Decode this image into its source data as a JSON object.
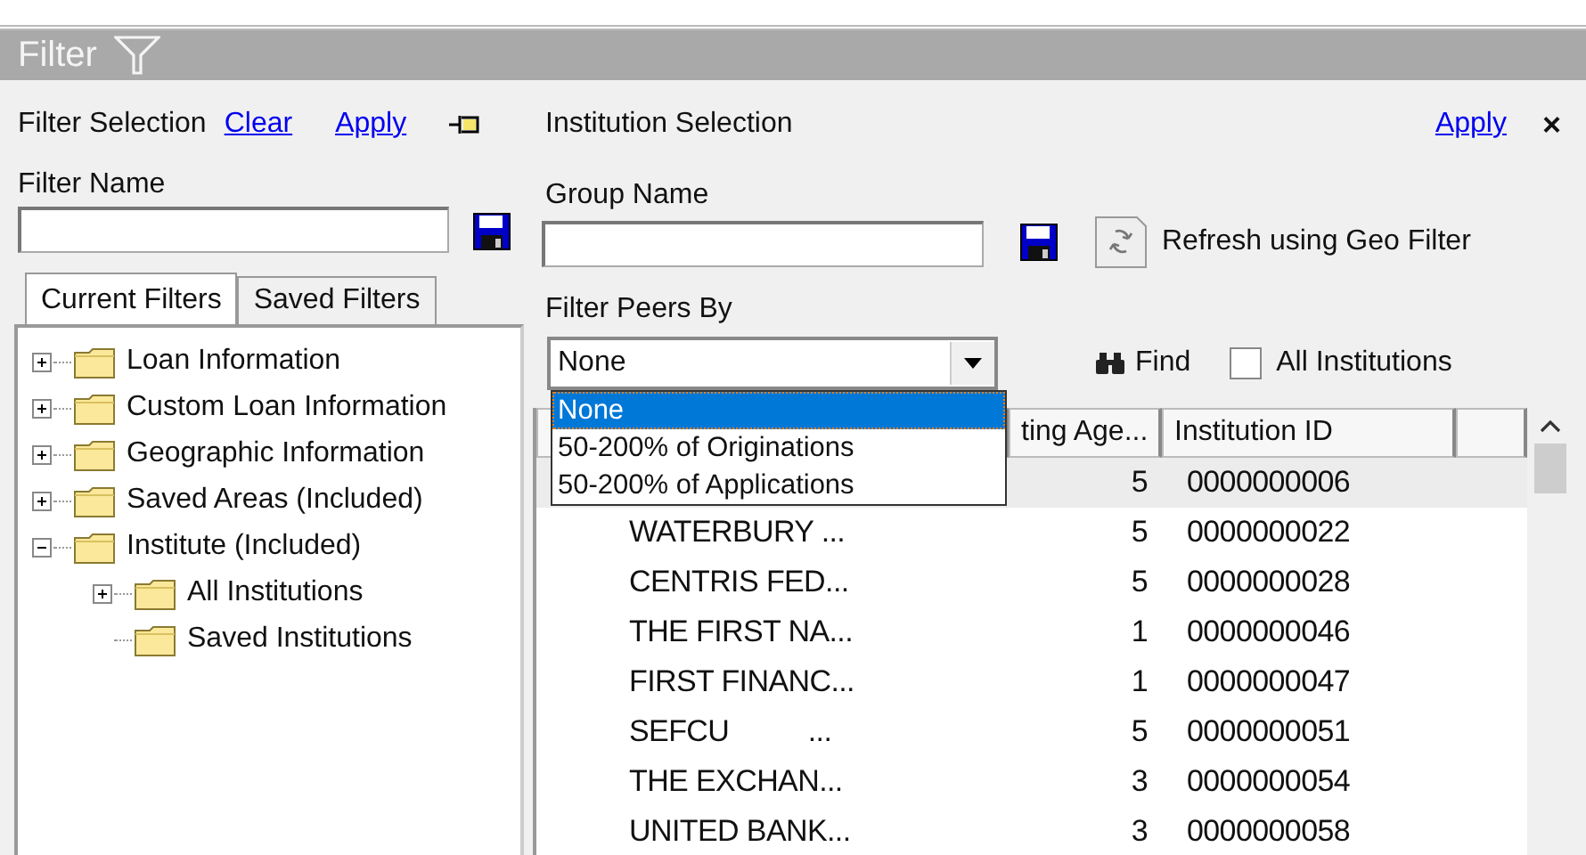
{
  "window": {
    "title": "Filter"
  },
  "filter_selection": {
    "label": "Filter Selection",
    "links": [
      "Clear",
      "Apply"
    ]
  },
  "filter_name": {
    "label": "Filter Name"
  },
  "tabs": [
    {
      "label": "Current Filters",
      "selected": true
    },
    {
      "label": "Saved Filters",
      "selected": false
    }
  ],
  "tree": [
    {
      "label": "Loan Information",
      "expandable": true,
      "expanded": false
    },
    {
      "label": "Custom Loan Information",
      "expandable": true,
      "expanded": false
    },
    {
      "label": "Geographic Information",
      "expandable": true,
      "expanded": false
    },
    {
      "label": "Saved Areas (Included)",
      "expandable": true,
      "expanded": false
    },
    {
      "label": "Institute (Included)",
      "expandable": true,
      "expanded": true,
      "children": [
        {
          "label": "All Institutions",
          "expandable": true,
          "expanded": false
        },
        {
          "label": "Saved Institutions",
          "expandable": false
        }
      ]
    }
  ],
  "institution_selection": {
    "label": "Institution Selection",
    "apply": "Apply",
    "close": "×"
  },
  "group_name": {
    "label": "Group Name"
  },
  "refresh_button": "Refresh using Geo Filter",
  "filter_peers": {
    "label": "Filter Peers By",
    "value": "None",
    "options": [
      {
        "label": "None",
        "selected": true
      },
      {
        "label": "50-200% of Originations",
        "selected": false
      },
      {
        "label": "50-200% of Applications",
        "selected": false
      }
    ]
  },
  "find_button": "Find",
  "all_institutions": {
    "label": "All Institutions",
    "checked": false
  },
  "table": {
    "columns": [
      "ting Age...",
      "Institution ID"
    ],
    "rows": [
      {
        "column_2": "5",
        "institution_id": "0000000006",
        "selected": true
      },
      {
        "column_1": "WATERBURY ...",
        "column_2": "5",
        "institution_id": "0000000022",
        "selected": false
      },
      {
        "column_1": "CENTRIS FED...",
        "column_2": "5",
        "institution_id": "0000000028",
        "selected": false
      },
      {
        "column_1": "THE FIRST NA...",
        "column_2": "1",
        "institution_id": "0000000046",
        "selected": false
      },
      {
        "column_1": "FIRST FINANC...",
        "column_2": "1",
        "institution_id": "0000000047",
        "selected": false
      },
      {
        "column_1": "SEFCU          ...",
        "column_2": "5",
        "institution_id": "0000000051",
        "selected": false
      },
      {
        "column_1": "THE EXCHAN...",
        "column_2": "3",
        "institution_id": "0000000054",
        "selected": false
      },
      {
        "column_1": "UNITED BANK...",
        "column_2": "3",
        "institution_id": "0000000058",
        "selected": false
      }
    ]
  }
}
